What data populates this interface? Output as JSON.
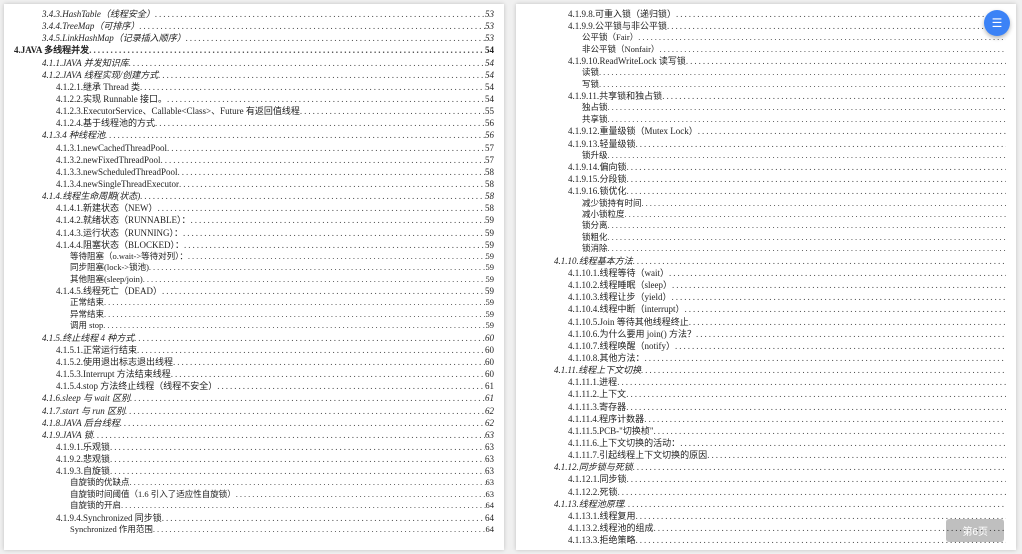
{
  "left_page": [
    {
      "num": "3.4.3.",
      "label": "HashTable（线程安全）",
      "pg": "53",
      "ind": 2,
      "it": 1
    },
    {
      "num": "3.4.4.",
      "label": "TreeMap（可排序）",
      "pg": "53",
      "ind": 2,
      "it": 1
    },
    {
      "num": "3.4.5.",
      "label": "LinkHashMap（记录插入顺序）",
      "pg": "53",
      "ind": 2,
      "it": 1
    },
    {
      "num": "4.",
      "label": "JAVA 多线程并发",
      "pg": "54",
      "ind": 0,
      "bold": 1
    },
    {
      "num": "4.1.1.",
      "label": "JAVA 并发知识库",
      "pg": "54",
      "ind": 2,
      "it": 1
    },
    {
      "num": "4.1.2.",
      "label": "JAVA 线程实现/创建方式",
      "pg": "54",
      "ind": 2,
      "it": 1
    },
    {
      "num": "4.1.2.1.",
      "label": "继承 Thread 类",
      "pg": "54",
      "ind": 3
    },
    {
      "num": "4.1.2.2.",
      "label": "实现 Runnable 接口。",
      "pg": "54",
      "ind": 3
    },
    {
      "num": "4.1.2.3.",
      "label": "ExecutorService、Callable<Class>、Future 有返回值线程",
      "pg": "55",
      "ind": 3
    },
    {
      "num": "4.1.2.4.",
      "label": "基于线程池的方式",
      "pg": "56",
      "ind": 3
    },
    {
      "num": "4.1.3.",
      "label": "4 种线程池",
      "pg": "56",
      "ind": 2,
      "it": 1
    },
    {
      "num": "4.1.3.1.",
      "label": "newCachedThreadPool",
      "pg": "57",
      "ind": 3
    },
    {
      "num": "4.1.3.2.",
      "label": "newFixedThreadPool",
      "pg": "57",
      "ind": 3
    },
    {
      "num": "4.1.3.3.",
      "label": "newScheduledThreadPool",
      "pg": "58",
      "ind": 3
    },
    {
      "num": "4.1.3.4.",
      "label": "newSingleThreadExecutor",
      "pg": "58",
      "ind": 3
    },
    {
      "num": "4.1.4.",
      "label": "线程生命周期(状态)",
      "pg": "58",
      "ind": 2,
      "it": 1
    },
    {
      "num": "4.1.4.1.",
      "label": "新建状态（NEW）",
      "pg": "58",
      "ind": 3
    },
    {
      "num": "4.1.4.2.",
      "label": "就绪状态（RUNNABLE）：",
      "pg": "59",
      "ind": 3
    },
    {
      "num": "4.1.4.3.",
      "label": "运行状态（RUNNING）：",
      "pg": "59",
      "ind": 3
    },
    {
      "num": "4.1.4.4.",
      "label": "阻塞状态（BLOCKED）：",
      "pg": "59",
      "ind": 3
    },
    {
      "num": "",
      "label": "等待阻塞（o.wait->等待对列）：",
      "pg": "59",
      "ind": 4
    },
    {
      "num": "",
      "label": "同步阻塞(lock->锁池)",
      "pg": "59",
      "ind": 4
    },
    {
      "num": "",
      "label": "其他阻塞(sleep/join)",
      "pg": "59",
      "ind": 4
    },
    {
      "num": "4.1.4.5.",
      "label": "线程死亡（DEAD）",
      "pg": "59",
      "ind": 3
    },
    {
      "num": "",
      "label": "正常结束",
      "pg": "59",
      "ind": 4
    },
    {
      "num": "",
      "label": "异常结束",
      "pg": "59",
      "ind": 4
    },
    {
      "num": "",
      "label": "调用 stop",
      "pg": "59",
      "ind": 4
    },
    {
      "num": "4.1.5.",
      "label": "终止线程 4 种方式",
      "pg": "60",
      "ind": 2,
      "it": 1
    },
    {
      "num": "4.1.5.1.",
      "label": "正常运行结束",
      "pg": "60",
      "ind": 3
    },
    {
      "num": "4.1.5.2.",
      "label": "使用退出标志退出线程",
      "pg": "60",
      "ind": 3
    },
    {
      "num": "4.1.5.3.",
      "label": "Interrupt 方法结束线程",
      "pg": "60",
      "ind": 3
    },
    {
      "num": "4.1.5.4.",
      "label": "stop 方法终止线程（线程不安全）",
      "pg": "61",
      "ind": 3
    },
    {
      "num": "4.1.6.",
      "label": "sleep 与 wait 区别",
      "pg": "61",
      "ind": 2,
      "it": 1
    },
    {
      "num": "4.1.7.",
      "label": "start 与 run 区别",
      "pg": "62",
      "ind": 2,
      "it": 1
    },
    {
      "num": "4.1.8.",
      "label": "JAVA 后台线程",
      "pg": "62",
      "ind": 2,
      "it": 1
    },
    {
      "num": "4.1.9.",
      "label": "JAVA 锁",
      "pg": "63",
      "ind": 2,
      "it": 1
    },
    {
      "num": "4.1.9.1.",
      "label": "乐观锁",
      "pg": "63",
      "ind": 3
    },
    {
      "num": "4.1.9.2.",
      "label": "悲观锁",
      "pg": "63",
      "ind": 3
    },
    {
      "num": "4.1.9.3.",
      "label": "自旋锁",
      "pg": "63",
      "ind": 3
    },
    {
      "num": "",
      "label": "自旋锁的优缺点",
      "pg": "63",
      "ind": 4
    },
    {
      "num": "",
      "label": "自旋锁时间阈值（1.6 引入了适应性自旋锁）",
      "pg": "63",
      "ind": 4
    },
    {
      "num": "",
      "label": "自旋锁的开启",
      "pg": "64",
      "ind": 4
    },
    {
      "num": "4.1.9.4.",
      "label": "Synchronized 同步锁",
      "pg": "64",
      "ind": 3
    },
    {
      "num": "",
      "label": "Synchronized 作用范围",
      "pg": "64",
      "ind": 4
    }
  ],
  "right_page": [
    {
      "num": "4.1.9.8.",
      "label": "可重入锁（递归锁）",
      "pg": "",
      "ind": 3
    },
    {
      "num": "4.1.9.9.",
      "label": "公平锁与非公平锁",
      "pg": "",
      "ind": 3
    },
    {
      "num": "",
      "label": "公平锁（Fair）",
      "pg": "",
      "ind": 4
    },
    {
      "num": "",
      "label": "非公平锁（Nonfair）",
      "pg": "",
      "ind": 4
    },
    {
      "num": "4.1.9.10.",
      "label": "ReadWriteLock 读写锁",
      "pg": "",
      "ind": 3
    },
    {
      "num": "",
      "label": "读锁",
      "pg": "",
      "ind": 4
    },
    {
      "num": "",
      "label": "写锁",
      "pg": "",
      "ind": 4
    },
    {
      "num": "4.1.9.11.",
      "label": "共享锁和独占锁",
      "pg": "",
      "ind": 3
    },
    {
      "num": "",
      "label": "独占锁",
      "pg": "",
      "ind": 4
    },
    {
      "num": "",
      "label": "共享锁",
      "pg": "",
      "ind": 4
    },
    {
      "num": "4.1.9.12.",
      "label": "重量级锁（Mutex Lock）",
      "pg": "",
      "ind": 3
    },
    {
      "num": "4.1.9.13.",
      "label": "轻量级锁",
      "pg": "",
      "ind": 3
    },
    {
      "num": "",
      "label": "锁升级",
      "pg": "",
      "ind": 4
    },
    {
      "num": "4.1.9.14.",
      "label": "偏向锁",
      "pg": "",
      "ind": 3
    },
    {
      "num": "4.1.9.15.",
      "label": "分段锁",
      "pg": "",
      "ind": 3
    },
    {
      "num": "4.1.9.16.",
      "label": "锁优化",
      "pg": "",
      "ind": 3
    },
    {
      "num": "",
      "label": "减少锁持有时间",
      "pg": "",
      "ind": 4
    },
    {
      "num": "",
      "label": "减小锁粒度",
      "pg": "",
      "ind": 4
    },
    {
      "num": "",
      "label": "锁分离",
      "pg": "",
      "ind": 4
    },
    {
      "num": "",
      "label": "锁粗化",
      "pg": "",
      "ind": 4
    },
    {
      "num": "",
      "label": "锁消除",
      "pg": "",
      "ind": 4
    },
    {
      "num": "4.1.10.",
      "label": "线程基本方法",
      "pg": "",
      "ind": 2,
      "it": 1
    },
    {
      "num": "4.1.10.1.",
      "label": "线程等待（wait）",
      "pg": "",
      "ind": 3
    },
    {
      "num": "4.1.10.2.",
      "label": "线程睡眠（sleep）",
      "pg": "",
      "ind": 3
    },
    {
      "num": "4.1.10.3.",
      "label": "线程让步（yield）",
      "pg": "",
      "ind": 3
    },
    {
      "num": "4.1.10.4.",
      "label": "线程中断（interrupt）",
      "pg": "",
      "ind": 3
    },
    {
      "num": "4.1.10.5.",
      "label": "Join 等待其他线程终止",
      "pg": "",
      "ind": 3
    },
    {
      "num": "4.1.10.6.",
      "label": "为什么要用 join() 方法？",
      "pg": "",
      "ind": 3
    },
    {
      "num": "4.1.10.7.",
      "label": "线程唤醒（notify）",
      "pg": "",
      "ind": 3
    },
    {
      "num": "4.1.10.8.",
      "label": "其他方法：",
      "pg": "",
      "ind": 3
    },
    {
      "num": "4.1.11.",
      "label": "线程上下文切换",
      "pg": "",
      "ind": 2,
      "it": 1
    },
    {
      "num": "4.1.11.1.",
      "label": "进程",
      "pg": "",
      "ind": 3
    },
    {
      "num": "4.1.11.2.",
      "label": "上下文",
      "pg": "",
      "ind": 3
    },
    {
      "num": "4.1.11.3.",
      "label": "寄存器",
      "pg": "",
      "ind": 3
    },
    {
      "num": "4.1.11.4.",
      "label": "程序计数器",
      "pg": "",
      "ind": 3
    },
    {
      "num": "4.1.11.5.",
      "label": "PCB-\"切换桢\"",
      "pg": "",
      "ind": 3
    },
    {
      "num": "4.1.11.6.",
      "label": "上下文切换的活动：",
      "pg": "",
      "ind": 3
    },
    {
      "num": "4.1.11.7.",
      "label": "引起线程上下文切换的原因",
      "pg": "",
      "ind": 3
    },
    {
      "num": "4.1.12.",
      "label": "同步锁与死锁",
      "pg": "",
      "ind": 2,
      "it": 1
    },
    {
      "num": "4.1.12.1.",
      "label": "同步锁",
      "pg": "",
      "ind": 3
    },
    {
      "num": "4.1.12.2.",
      "label": "死锁",
      "pg": "",
      "ind": 3
    },
    {
      "num": "4.1.13.",
      "label": "线程池原理",
      "pg": "",
      "ind": 2,
      "it": 1
    },
    {
      "num": "4.1.13.1.",
      "label": "线程复用",
      "pg": "",
      "ind": 3
    },
    {
      "num": "4.1.13.2.",
      "label": "线程池的组成",
      "pg": "",
      "ind": 3
    },
    {
      "num": "4.1.13.3.",
      "label": "拒绝策略",
      "pg": "",
      "ind": 3
    }
  ],
  "float_icon": "☰",
  "page_indicator": "第6页"
}
